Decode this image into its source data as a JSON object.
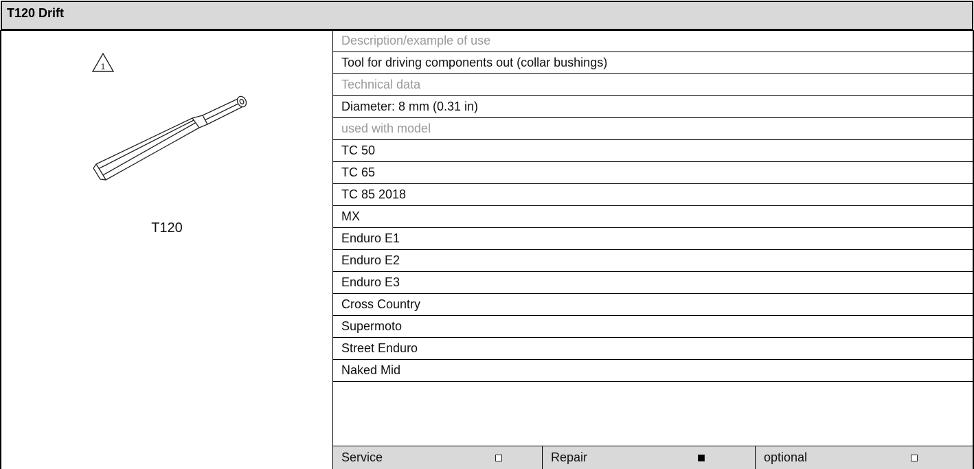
{
  "header": {
    "title": "T120 Drift"
  },
  "figure": {
    "warning_icon": "warning-triangle-1-icon",
    "warning_number": "1",
    "tool_label": "T120"
  },
  "rows": [
    {
      "text": "Description/example of use",
      "muted": true
    },
    {
      "text": "Tool for driving components out (collar bushings)",
      "muted": false
    },
    {
      "text": "Technical data",
      "muted": true
    },
    {
      "text": "Diameter: 8 mm (0.31 in)",
      "muted": false
    },
    {
      "text": "used with model",
      "muted": true
    },
    {
      "text": "TC 50",
      "muted": false
    },
    {
      "text": "TC 65",
      "muted": false
    },
    {
      "text": "TC 85 2018",
      "muted": false
    },
    {
      "text": "MX",
      "muted": false
    },
    {
      "text": "Enduro E1",
      "muted": false
    },
    {
      "text": "Enduro E2",
      "muted": false
    },
    {
      "text": "Enduro E3",
      "muted": false
    },
    {
      "text": "Cross Country",
      "muted": false
    },
    {
      "text": "Supermoto",
      "muted": false
    },
    {
      "text": "Street Enduro",
      "muted": false
    },
    {
      "text": "Naked Mid",
      "muted": false
    }
  ],
  "footer": {
    "service": {
      "label": "Service",
      "checked": false
    },
    "repair": {
      "label": "Repair",
      "checked": true
    },
    "optional": {
      "label": "optional",
      "checked": false
    }
  },
  "colors": {
    "header_bg": "#d9d9d9",
    "muted_text": "#9a9a9a",
    "border": "#000000"
  }
}
